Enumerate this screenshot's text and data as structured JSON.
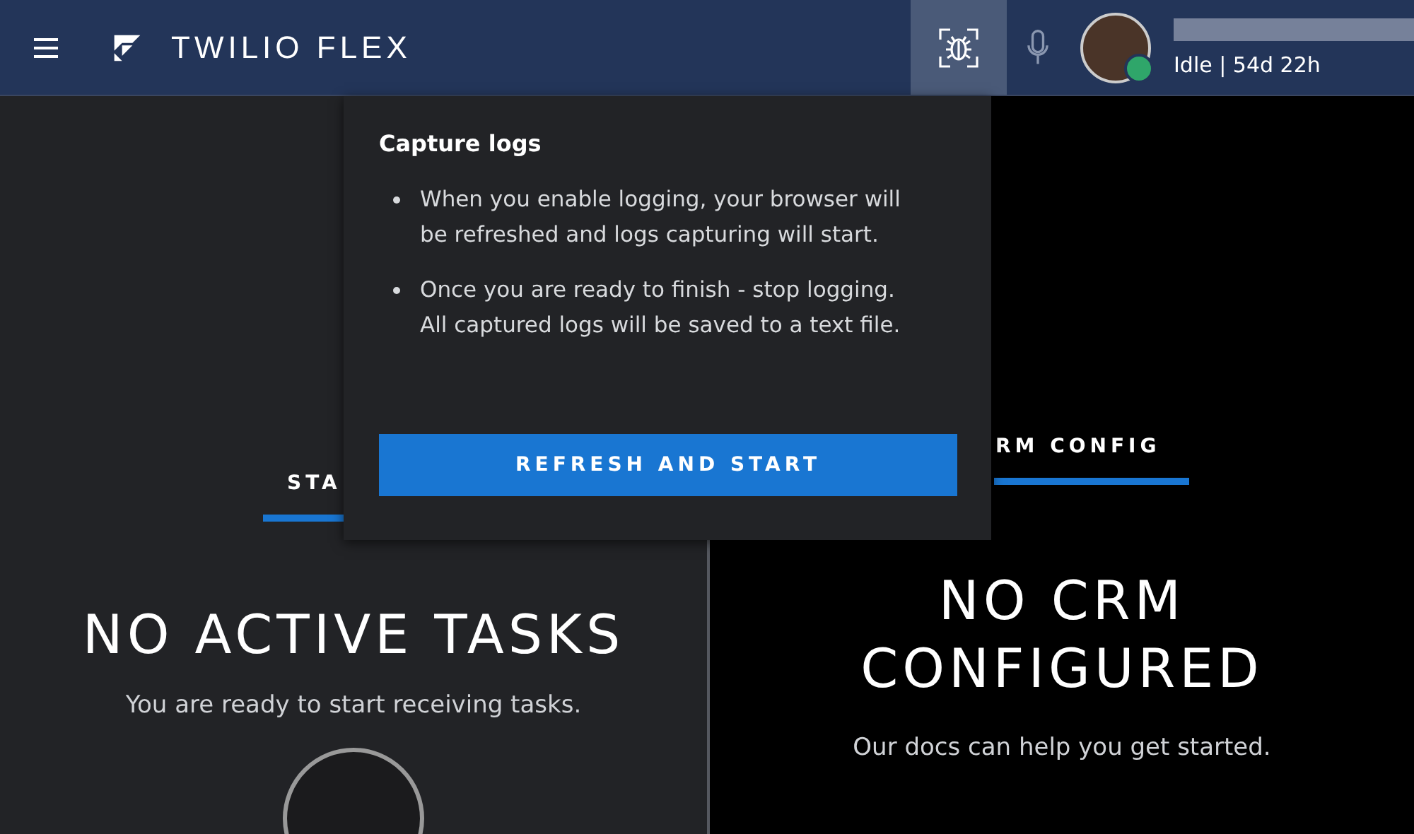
{
  "header": {
    "brand": "TWILIO FLEX",
    "debug_active": true,
    "user": {
      "status": "Idle | 54d 22h",
      "available": true
    }
  },
  "left_panel": {
    "tab": {
      "label": "STA",
      "selected": true
    },
    "title": "NO ACTIVE TASKS",
    "subtitle": "You are ready to start receiving tasks."
  },
  "right_panel": {
    "tab": {
      "label": "RM CONFIG",
      "selected": true
    },
    "title_lines": [
      "NO CRM",
      "CONFIGURED"
    ],
    "subtitle": "Our docs can help you get started."
  },
  "popover": {
    "title": "Capture logs",
    "bullets": [
      "When you enable logging, your browser will be refreshed and logs capturing will start.",
      "Once you are ready to finish - stop logging. All captured logs will be saved to a text file."
    ],
    "button": "REFRESH AND START"
  }
}
